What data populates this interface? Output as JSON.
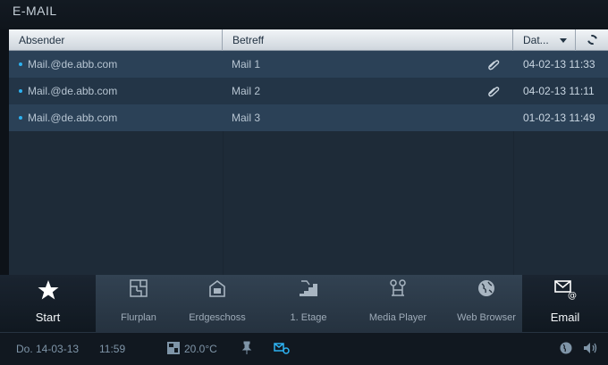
{
  "app": {
    "title": "E-MAIL"
  },
  "table": {
    "headers": {
      "sender": "Absender",
      "subject": "Betreff",
      "date": "Dat..."
    },
    "rows": [
      {
        "sender": "Mail.@de.abb.com",
        "subject": "Mail 1",
        "date": "04-02-13 11:33",
        "attachment": true
      },
      {
        "sender": "Mail.@de.abb.com",
        "subject": "Mail 2",
        "date": "04-02-13 11:11",
        "attachment": true
      },
      {
        "sender": "Mail.@de.abb.com",
        "subject": "Mail 3",
        "date": "01-02-13 11:49",
        "attachment": false
      }
    ]
  },
  "nav": {
    "items": [
      {
        "label": "Start",
        "icon": "star-icon"
      },
      {
        "label": "Flurplan",
        "icon": "floorplan-icon"
      },
      {
        "label": "Erdgeschoss",
        "icon": "house-icon"
      },
      {
        "label": "1. Etage",
        "icon": "stairs-icon"
      },
      {
        "label": "Media Player",
        "icon": "media-player-icon"
      },
      {
        "label": "Web Browser",
        "icon": "globe-icon"
      },
      {
        "label": "Email",
        "icon": "email-icon"
      }
    ]
  },
  "status": {
    "date": "Do. 14-03-13",
    "time": "11:59",
    "temperature": "20.0°C"
  },
  "colors": {
    "accent": "#2db1f0",
    "row_dark": "#233547",
    "row_light": "#2b4157"
  }
}
